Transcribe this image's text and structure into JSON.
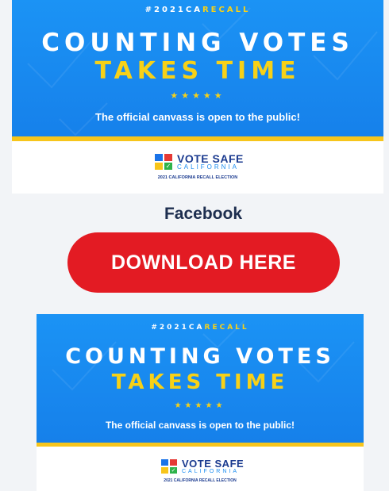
{
  "banner_top": {
    "hashtag_prefix": "#2021CA",
    "hashtag_suffix": "RECALL",
    "title_line1": "COUNTING VOTES",
    "title_line2": "TAKES TIME",
    "stars": "★★★★★",
    "subtitle": "The official canvass is open to the public!",
    "logo_title": "VOTE SAFE",
    "logo_state": "CALIFORNIA",
    "logo_sub": "2021 CALIFORNIA RECALL ELECTION"
  },
  "section_label": "Facebook",
  "download_button": "DOWNLOAD HERE",
  "banner_bottom": {
    "hashtag_prefix": "#2021CA",
    "hashtag_suffix": "RECALL",
    "title_line1": "COUNTING VOTES",
    "title_line2": "TAKES TIME",
    "stars": "★★★★★",
    "subtitle": "The official canvass is open to the public!",
    "logo_title": "VOTE SAFE",
    "logo_state": "CALIFORNIA",
    "logo_sub": "2021 CALIFORNIA RECALL ELECTION"
  },
  "colors": {
    "banner_blue": "#1a8cf0",
    "accent_yellow": "#f7d117",
    "button_red": "#e31b23",
    "label_navy": "#1d2e4f"
  }
}
